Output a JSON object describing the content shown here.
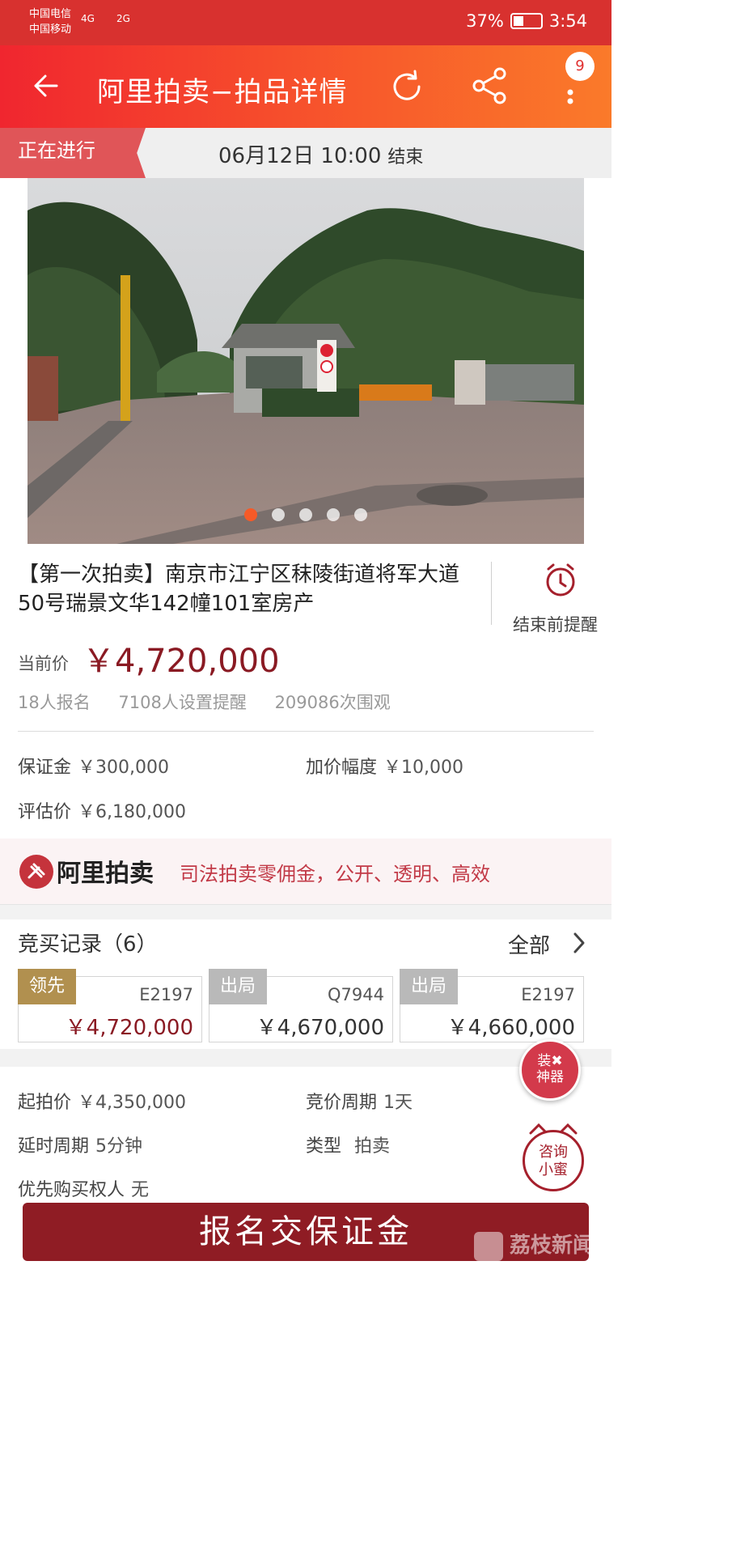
{
  "status_bar": {
    "carrier1": "中国电信",
    "carrier2": "中国移动",
    "signal1": "4G",
    "signal2": "2G",
    "battery": "37%",
    "time": "3:54"
  },
  "header": {
    "title": "阿里拍卖−拍品详情",
    "notification_count": "9"
  },
  "auction_status": {
    "label": "正在进行",
    "end_time": "06月12日 10:00",
    "end_suffix": "结束"
  },
  "gallery": {
    "image_count": 5,
    "active_index": 0
  },
  "lot": {
    "title": "【第一次拍卖】南京市江宁区秣陵街道将军大道50号瑞景文华142幢101室房产",
    "reminder_label": "结束前提醒",
    "price_label": "当前价",
    "price": "￥4,720,000",
    "signups": "18人报名",
    "reminders": "7108人设置提醒",
    "views": "209086次围观"
  },
  "terms": {
    "deposit_label": "保证金",
    "deposit": "￥300,000",
    "increment_label": "加价幅度",
    "increment": "￥10,000",
    "appraisal_label": "评估价",
    "appraisal": "￥6,180,000"
  },
  "banner": {
    "brand": "阿里拍卖",
    "slogan": "司法拍卖零佣金，公开、透明、高效"
  },
  "bids": {
    "title": "竞买记录（6）",
    "all_label": "全部",
    "records": [
      {
        "status": "领先",
        "bidder": "E2197",
        "amount": "￥4,720,000"
      },
      {
        "status": "出局",
        "bidder": "Q7944",
        "amount": "￥4,670,000"
      },
      {
        "status": "出局",
        "bidder": "E2197",
        "amount": "￥4,660,000"
      }
    ]
  },
  "details": {
    "start_price_label": "起拍价",
    "start_price": "￥4,350,000",
    "cycle_label": "竞价周期",
    "cycle": "1天",
    "delay_label": "延时周期",
    "delay": "5分钟",
    "type_label": "类型",
    "type": "拍卖",
    "priority_label": "优先购买权人",
    "priority": "无"
  },
  "floating": {
    "tool_line1": "装✖",
    "tool_line2": "神器",
    "consult_line1": "咨询",
    "consult_line2": "小蜜"
  },
  "action": {
    "button": "报名交保证金"
  },
  "watermark": "荔枝新闻",
  "colors": {
    "brand_red": "#f0262f",
    "price_red": "#8a1a23",
    "button": "#8f1c24",
    "lead_tag": "#b1904f"
  }
}
